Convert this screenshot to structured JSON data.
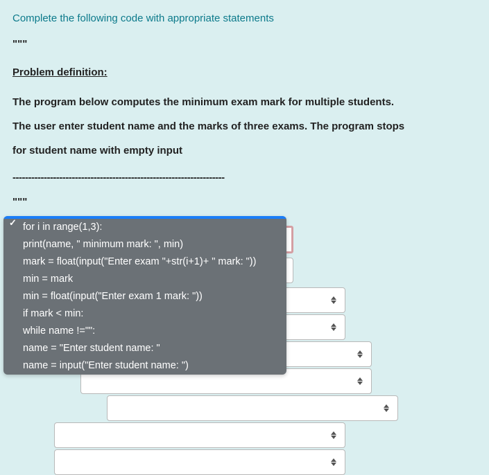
{
  "header": "Complete the following code with appropriate statements",
  "triple_quote": "\"\"\"",
  "problem_heading": "Problem definition:",
  "para1": "The program below computes the minimum exam mark for multiple students.",
  "para2": "The user enter student name and the marks of three exams. The program stops",
  "para3": "for student name with empty input",
  "divider": "--------------------------------------------------------------------",
  "triple_quote2": "\"\"\"",
  "popup": {
    "items": [
      "",
      "for i in range(1,3):",
      "print(name, \" minimum mark: \", min)",
      "mark = float(input(\"Enter exam \"+str(i+1)+ \" mark: \"))",
      "min = mark",
      "min = float(input(\"Enter exam 1 mark: \"))",
      "if mark < min:",
      "while name !=\"\":",
      "name = \"Enter student name: \"",
      "name = input(\"Enter student name: \")"
    ],
    "selected_index": 0
  }
}
